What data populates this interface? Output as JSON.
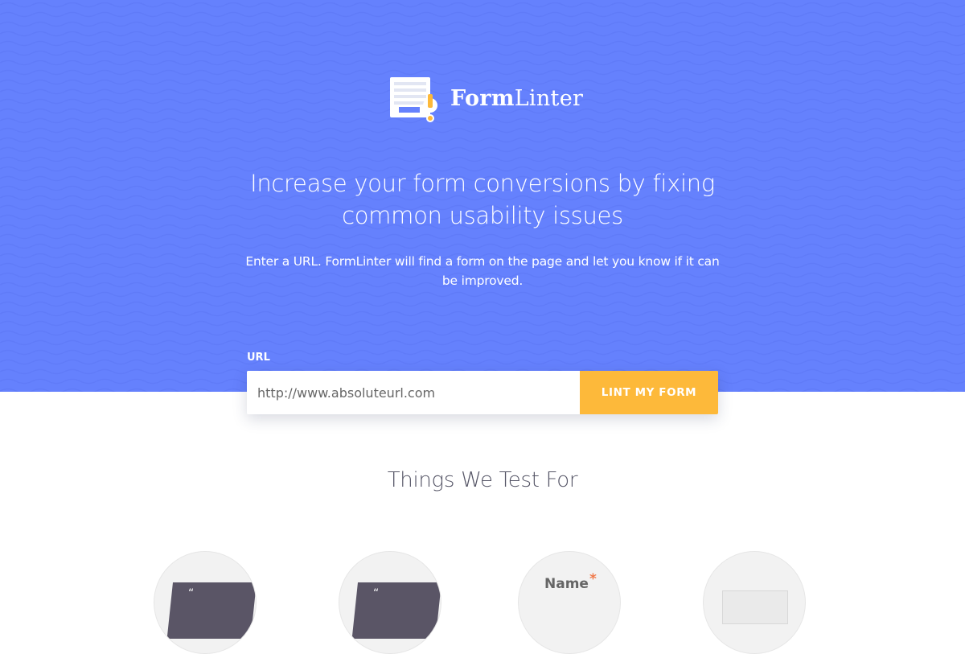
{
  "brand": {
    "name_part1": "Form",
    "name_part2": "Linter"
  },
  "hero": {
    "headline_line1": "Increase your form conversions by fixing",
    "headline_line2": "common usability issues",
    "subline": "Enter a URL. FormLinter will find a form on the page and let you know if it can be improved."
  },
  "form": {
    "url_label": "URL",
    "url_placeholder": "http://www.absoluteurl.com",
    "submit_label": "LINT MY FORM"
  },
  "tests_section": {
    "title": "Things We Test For",
    "items": [
      {
        "preview_text": "“"
      },
      {
        "preview_text": "“"
      },
      {
        "preview_label": "Name",
        "required_mark": "*"
      },
      {
        "preview_text": ""
      }
    ]
  },
  "colors": {
    "hero_background": "#6581fd",
    "accent_button": "#fdb93a",
    "text_white": "#ffffff",
    "section_title": "#555566",
    "logo_alert": "#fdb93a",
    "logo_bar": "#6581fd"
  },
  "icons": {
    "logo": "form-alert-logo-icon"
  }
}
